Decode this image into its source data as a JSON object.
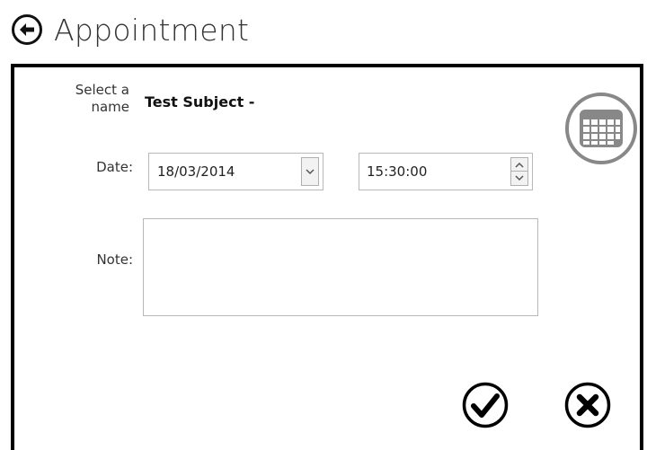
{
  "header": {
    "title": "Appointment",
    "back_icon": "arrow-left-circle-icon"
  },
  "form": {
    "select_label": "Select a name",
    "subject_name": "Test Subject -",
    "date_label": "Date:",
    "date_value": "18/03/2014",
    "time_value": "15:30:00",
    "note_label": "Note:",
    "note_value": ""
  },
  "icons": {
    "calendar": "calendar-icon",
    "confirm": "checkmark-circle-icon",
    "cancel": "close-circle-icon"
  },
  "colors": {
    "panel_border": "#000000",
    "field_border": "#b8b8b8",
    "calendar_ring": "#888888"
  }
}
